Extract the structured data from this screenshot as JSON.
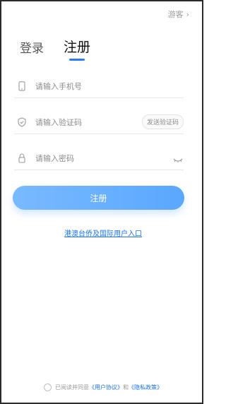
{
  "header": {
    "guest_label": "游客",
    "guest_chevron": "chevron-right-icon"
  },
  "tabs": [
    {
      "label": "登录",
      "active": false
    },
    {
      "label": "注册",
      "active": true
    }
  ],
  "form": {
    "phone": {
      "placeholder": "请输入手机号",
      "icon": "phone-icon"
    },
    "code": {
      "placeholder": "请输入验证码",
      "icon": "shield-icon",
      "send_label": "发送验证码"
    },
    "password": {
      "placeholder": "请输入密码",
      "icon": "lock-icon",
      "toggle_icon": "eye-closed-icon"
    },
    "submit_label": "注册"
  },
  "hk_link": "港澳台侨及国际用户入口",
  "agreement": {
    "prefix": "已阅读并同意",
    "user_agreement": "《用户协议》",
    "and": "和",
    "privacy_policy": "《隐私政策》"
  },
  "colors": {
    "accent": "#2a7bf6",
    "button_start": "#79baff",
    "button_end": "#5aa7ff",
    "link": "#1a73e8"
  }
}
